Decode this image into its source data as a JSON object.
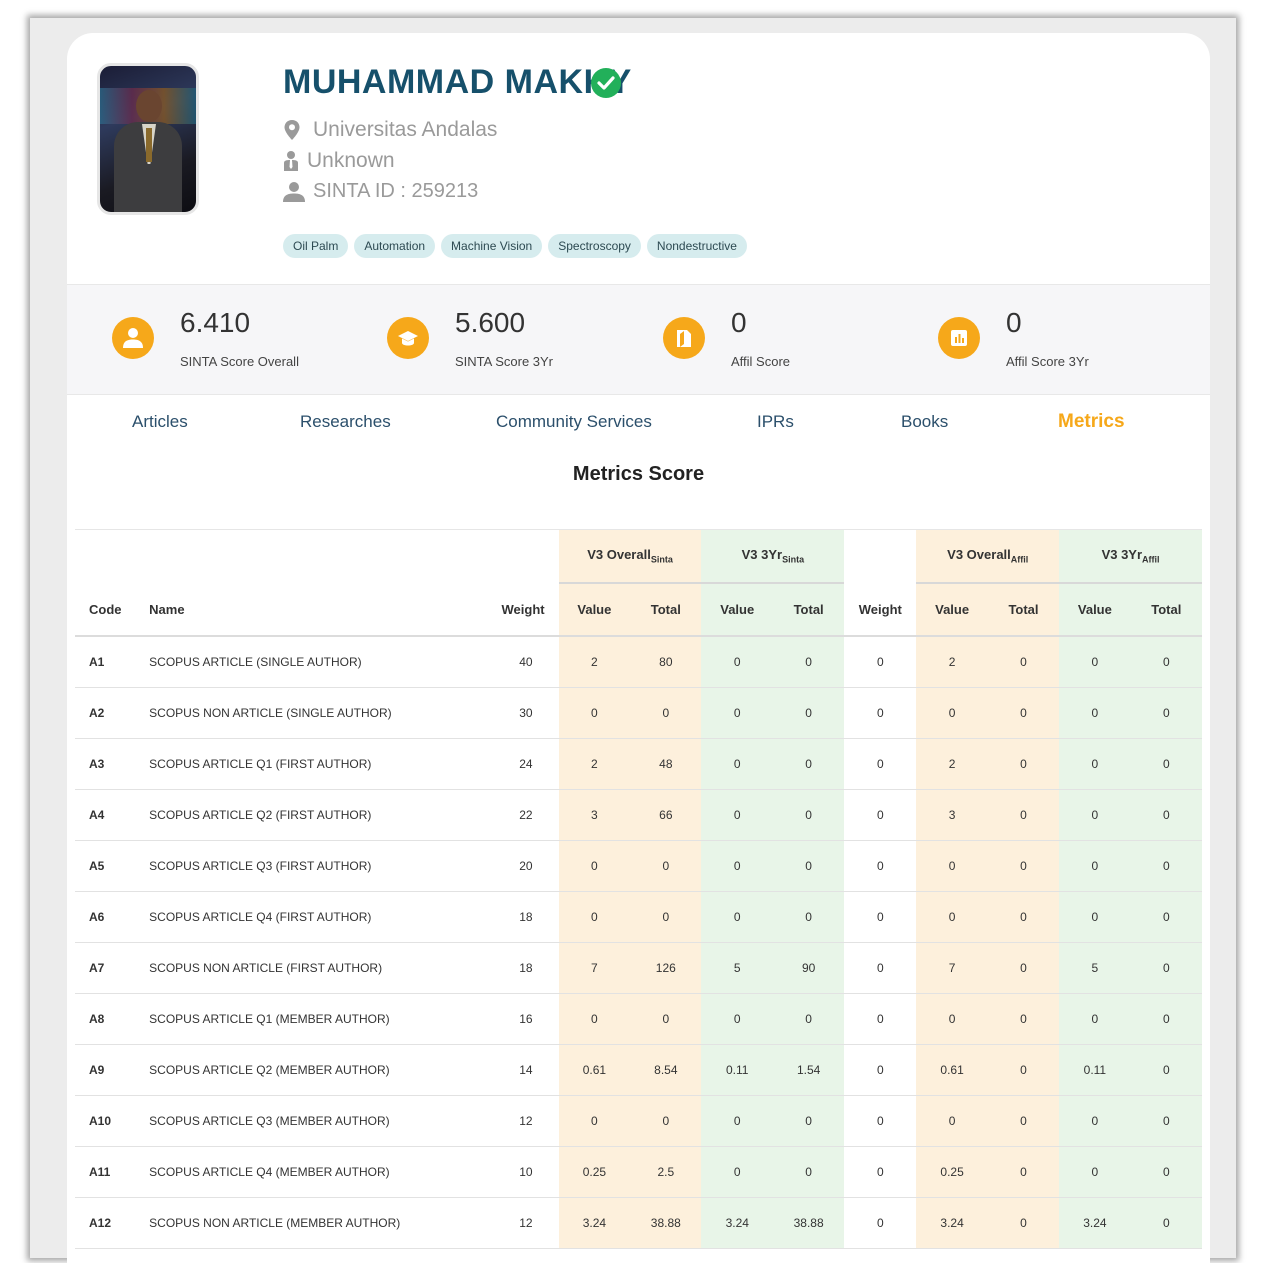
{
  "profile": {
    "name": "MUHAMMAD MAKKY",
    "affiliation": "Universitas Andalas",
    "department": "Unknown",
    "sinta_id": "SINTA ID : 259213",
    "tags": [
      "Oil Palm",
      "Automation",
      "Machine Vision",
      "Spectroscopy",
      "Nondestructive"
    ]
  },
  "scores": [
    {
      "value": "6.410",
      "label": "SINTA Score Overall",
      "icon": "user-icon"
    },
    {
      "value": "5.600",
      "label": "SINTA Score 3Yr",
      "icon": "graduation-cap-icon"
    },
    {
      "value": "0",
      "label": "Affil Score",
      "icon": "book-icon"
    },
    {
      "value": "0",
      "label": "Affil Score 3Yr",
      "icon": "bar-chart-icon"
    }
  ],
  "tabs": [
    "Articles",
    "Researches",
    "Community Services",
    "IPRs",
    "Books",
    "Metrics"
  ],
  "active_tab": "Metrics",
  "metrics_title": "Metrics Score",
  "table": {
    "groups": [
      {
        "main": "V3 Overall",
        "sub": "Sinta"
      },
      {
        "main": "V3 3Yr",
        "sub": "Sinta"
      },
      {
        "main": "V3 Overall",
        "sub": "Affil"
      },
      {
        "main": "V3 3Yr",
        "sub": "Affil"
      }
    ],
    "col_code": "Code",
    "col_name": "Name",
    "col_weight": "Weight",
    "col_value": "Value",
    "col_total": "Total",
    "rows": [
      [
        "A1",
        "SCOPUS ARTICLE (SINGLE AUTHOR)",
        "40",
        "2",
        "80",
        "0",
        "0",
        "0",
        "2",
        "0",
        "0",
        "0"
      ],
      [
        "A2",
        "SCOPUS NON ARTICLE (SINGLE AUTHOR)",
        "30",
        "0",
        "0",
        "0",
        "0",
        "0",
        "0",
        "0",
        "0",
        "0"
      ],
      [
        "A3",
        "SCOPUS ARTICLE Q1 (FIRST AUTHOR)",
        "24",
        "2",
        "48",
        "0",
        "0",
        "0",
        "2",
        "0",
        "0",
        "0"
      ],
      [
        "A4",
        "SCOPUS ARTICLE Q2 (FIRST AUTHOR)",
        "22",
        "3",
        "66",
        "0",
        "0",
        "0",
        "3",
        "0",
        "0",
        "0"
      ],
      [
        "A5",
        "SCOPUS ARTICLE Q3 (FIRST AUTHOR)",
        "20",
        "0",
        "0",
        "0",
        "0",
        "0",
        "0",
        "0",
        "0",
        "0"
      ],
      [
        "A6",
        "SCOPUS ARTICLE Q4 (FIRST AUTHOR)",
        "18",
        "0",
        "0",
        "0",
        "0",
        "0",
        "0",
        "0",
        "0",
        "0"
      ],
      [
        "A7",
        "SCOPUS NON ARTICLE (FIRST AUTHOR)",
        "18",
        "7",
        "126",
        "5",
        "90",
        "0",
        "7",
        "0",
        "5",
        "0"
      ],
      [
        "A8",
        "SCOPUS ARTICLE Q1 (MEMBER AUTHOR)",
        "16",
        "0",
        "0",
        "0",
        "0",
        "0",
        "0",
        "0",
        "0",
        "0"
      ],
      [
        "A9",
        "SCOPUS ARTICLE Q2 (MEMBER AUTHOR)",
        "14",
        "0.61",
        "8.54",
        "0.11",
        "1.54",
        "0",
        "0.61",
        "0",
        "0.11",
        "0"
      ],
      [
        "A10",
        "SCOPUS ARTICLE Q3 (MEMBER AUTHOR)",
        "12",
        "0",
        "0",
        "0",
        "0",
        "0",
        "0",
        "0",
        "0",
        "0"
      ],
      [
        "A11",
        "SCOPUS ARTICLE Q4 (MEMBER AUTHOR)",
        "10",
        "0.25",
        "2.5",
        "0",
        "0",
        "0",
        "0.25",
        "0",
        "0",
        "0"
      ],
      [
        "A12",
        "SCOPUS NON ARTICLE (MEMBER AUTHOR)",
        "12",
        "3.24",
        "38.88",
        "3.24",
        "38.88",
        "0",
        "3.24",
        "0",
        "3.24",
        "0"
      ]
    ]
  },
  "colors": {
    "name": "#16506b",
    "accent": "#f6a81a",
    "verified": "#22b05a",
    "tag_bg": "#d6ecee",
    "orange_band": "#fdf0dc",
    "green_band": "#e8f5e8"
  }
}
